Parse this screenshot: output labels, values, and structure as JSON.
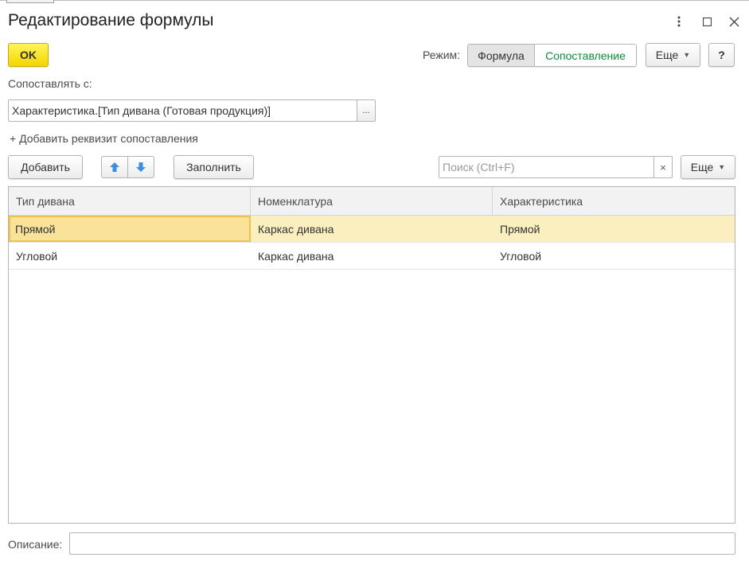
{
  "window": {
    "title": "Редактирование формулы"
  },
  "toolbar": {
    "ok_label": "OK",
    "mode_label": "Режим:",
    "mode_options": [
      "Формула",
      "Сопоставление"
    ],
    "more_label": "Еще",
    "help_label": "?"
  },
  "match": {
    "label": "Сопоставлять с:",
    "value": "Характеристика.[Тип дивана (Готовая продукция)]",
    "select_label": "...",
    "add_attr_label": "+ Добавить реквизит сопоставления"
  },
  "table_toolbar": {
    "add_label": "Добавить",
    "fill_label": "Заполнить",
    "search_placeholder": "Поиск (Ctrl+F)",
    "clear_label": "×",
    "more_label": "Еще"
  },
  "table": {
    "columns": [
      "Тип дивана",
      "Номенклатура",
      "Характеристика"
    ],
    "rows": [
      [
        "Прямой",
        "Каркас дивана",
        "Прямой"
      ],
      [
        "Угловой",
        "Каркас дивана",
        "Угловой"
      ]
    ]
  },
  "footer": {
    "description_label": "Описание:",
    "description_value": ""
  },
  "colors": {
    "accent_yellow": "#f3d500",
    "mode_inactive_text": "#0d8c3b",
    "selected_row": "#fbefbf",
    "arrow_blue": "#3a8ee6"
  }
}
